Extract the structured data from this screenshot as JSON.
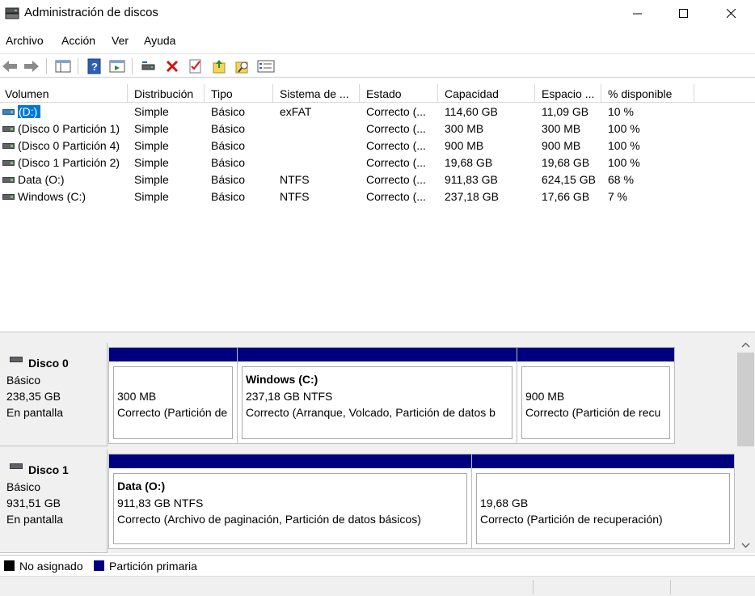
{
  "window": {
    "title": "Administración de discos",
    "icon": "disk-management-icon"
  },
  "menu": [
    "Archivo",
    "Acción",
    "Ver",
    "Ayuda"
  ],
  "toolbar": [
    "back-arrow-icon",
    "forward-arrow-icon",
    "console-tree-icon",
    "help-icon",
    "action-pane-icon",
    "connect-drive-icon",
    "delete-icon",
    "properties-check-icon",
    "open-folder-icon",
    "explore-icon",
    "settings-list-icon"
  ],
  "columns": [
    "Volumen",
    "Distribución",
    "Tipo",
    "Sistema de ...",
    "Estado",
    "Capacidad",
    "Espacio ...",
    "% disponible"
  ],
  "volumes": [
    {
      "volume": "(D:)",
      "layout": "Simple",
      "type": "Básico",
      "fs": "exFAT",
      "status": "Correcto (...",
      "capacity": "114,60 GB",
      "free": "11,09 GB",
      "pct": "10 %",
      "selected": true
    },
    {
      "volume": "(Disco 0 Partición 1)",
      "layout": "Simple",
      "type": "Básico",
      "fs": "",
      "status": "Correcto (...",
      "capacity": "300 MB",
      "free": "300 MB",
      "pct": "100 %"
    },
    {
      "volume": "(Disco 0 Partición 4)",
      "layout": "Simple",
      "type": "Básico",
      "fs": "",
      "status": "Correcto (...",
      "capacity": "900 MB",
      "free": "900 MB",
      "pct": "100 %"
    },
    {
      "volume": "(Disco 1 Partición 2)",
      "layout": "Simple",
      "type": "Básico",
      "fs": "",
      "status": "Correcto (...",
      "capacity": "19,68 GB",
      "free": "19,68 GB",
      "pct": "100 %"
    },
    {
      "volume": "Data (O:)",
      "layout": "Simple",
      "type": "Básico",
      "fs": "NTFS",
      "status": "Correcto (...",
      "capacity": "911,83 GB",
      "free": "624,15 GB",
      "pct": "68 %"
    },
    {
      "volume": "Windows (C:)",
      "layout": "Simple",
      "type": "Básico",
      "fs": "NTFS",
      "status": "Correcto (...",
      "capacity": "237,18 GB",
      "free": "17,66 GB",
      "pct": "7 %"
    }
  ],
  "disks": [
    {
      "name": "Disco 0",
      "type": "Básico",
      "size": "238,35 GB",
      "state": "En pantalla",
      "partitions": [
        {
          "name": "",
          "size": "300 MB",
          "status": "Correcto (Partición de"
        },
        {
          "name": "Windows  (C:)",
          "size": "237,18 GB NTFS",
          "status": "Correcto (Arranque, Volcado, Partición de datos b"
        },
        {
          "name": "",
          "size": "900 MB",
          "status": "Correcto (Partición de recu"
        }
      ]
    },
    {
      "name": "Disco 1",
      "type": "Básico",
      "size": "931,51 GB",
      "state": "En pantalla",
      "partitions": [
        {
          "name": "Data  (O:)",
          "size": "911,83 GB NTFS",
          "status": "Correcto (Archivo de paginación, Partición de datos básicos)"
        },
        {
          "name": "",
          "size": "19,68 GB",
          "status": "Correcto (Partición de recuperación)"
        }
      ]
    }
  ],
  "legend": [
    {
      "label": "No asignado",
      "color": "#000000"
    },
    {
      "label": "Partición primaria",
      "color": "#00007e"
    }
  ]
}
